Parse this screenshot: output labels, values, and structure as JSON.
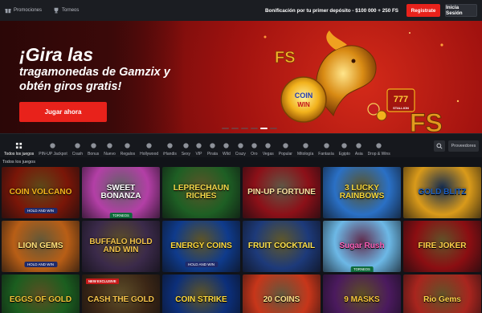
{
  "topbar": {
    "tabs": [
      {
        "label": "Promociones",
        "icon": "gift-icon"
      },
      {
        "label": "Torneos",
        "icon": "trophy-icon"
      }
    ],
    "bonus_text": "Bonificación por tu primer depósito - $100 000 + 250 FS",
    "register_label": "Registrate",
    "login_label": "Inicia Sesión"
  },
  "banner": {
    "title": "¡Gira las",
    "subtitle": "tragamonedas de Gamzix y obtén giros gratis!",
    "cta_label": "Jugar ahora",
    "art_fs": "FS",
    "art_coin": "COIN",
    "art_win": "WIN",
    "art_badge": "777",
    "art_badge_sub": "STALLION",
    "slide_count": 6,
    "active_slide": 4
  },
  "categories": [
    {
      "label": "Todos los juegos",
      "icon": "grid-icon"
    },
    {
      "label": "PIN-UP Jackpot",
      "icon": "jackpot-icon"
    },
    {
      "label": "Crash",
      "icon": "rocket-icon"
    },
    {
      "label": "Bonus",
      "icon": "bonus-icon"
    },
    {
      "label": "Nuevo",
      "icon": "new-icon"
    },
    {
      "label": "Regalos",
      "icon": "gift-icon"
    },
    {
      "label": "Hollywood",
      "icon": "star-icon"
    },
    {
      "label": "iHandis",
      "icon": "hand-icon"
    },
    {
      "label": "Sexy",
      "icon": "heart-icon"
    },
    {
      "label": "VIP",
      "icon": "crown-icon"
    },
    {
      "label": "Pirata",
      "icon": "pirate-icon"
    },
    {
      "label": "Wild",
      "icon": "wild-icon"
    },
    {
      "label": "Crazy",
      "icon": "crazy-icon"
    },
    {
      "label": "Oro",
      "icon": "gold-icon"
    },
    {
      "label": "Vegas",
      "icon": "dice-icon"
    },
    {
      "label": "Popular",
      "icon": "fire-icon"
    },
    {
      "label": "Mitología",
      "icon": "myth-icon"
    },
    {
      "label": "Fantasía",
      "icon": "wand-icon"
    },
    {
      "label": "Egipto",
      "icon": "pyramid-icon"
    },
    {
      "label": "Asia",
      "icon": "lantern-icon"
    },
    {
      "label": "Drop & Wins",
      "icon": "drop-icon"
    }
  ],
  "search_icon": "search-icon",
  "providers_label": "Proveedores",
  "section_title": "Todos los juegos",
  "games": [
    {
      "name": "COIN VOLCANO",
      "sub": "HOLD AND WIN",
      "bg": "#7a1608",
      "accent": "#f5b51b",
      "tag": "",
      "torneo": ""
    },
    {
      "name": "SWEET BONANZA",
      "sub": "",
      "bg": "#b33fa6",
      "accent": "#ffffff",
      "tag": "",
      "torneo": "TORNEOS"
    },
    {
      "name": "LEPRECHAUN RICHES",
      "sub": "",
      "bg": "#1e5f24",
      "accent": "#f2d649",
      "tag": "",
      "torneo": ""
    },
    {
      "name": "PIN-UP FORTUNE",
      "sub": "",
      "bg": "#8c1018",
      "accent": "#fbe3a2",
      "tag": "",
      "torneo": ""
    },
    {
      "name": "3 LUCKY RAINBOWS",
      "sub": "",
      "bg": "#2a70c5",
      "accent": "#f5d63b",
      "tag": "",
      "torneo": ""
    },
    {
      "name": "GOLD BLITZ",
      "sub": "",
      "bg": "#d99a1a",
      "accent": "#1b5dbf",
      "tag": "",
      "torneo": ""
    },
    {
      "name": "LION GEMS",
      "sub": "HOLD AND WIN",
      "bg": "#b85e16",
      "accent": "#ffe17a",
      "tag": "",
      "torneo": ""
    },
    {
      "name": "BUFFALO HOLD AND WIN",
      "sub": "",
      "bg": "#3b2a4a",
      "accent": "#f1c24a",
      "tag": "",
      "torneo": ""
    },
    {
      "name": "ENERGY COINS",
      "sub": "HOLD AND WIN",
      "bg": "#0f3b8c",
      "accent": "#ffd93a",
      "tag": "",
      "torneo": ""
    },
    {
      "name": "FRUIT COCKTAIL",
      "sub": "",
      "bg": "#1d3a7a",
      "accent": "#ffe24a",
      "tag": "",
      "torneo": ""
    },
    {
      "name": "Sugar Rush",
      "sub": "",
      "bg": "#6cb8e6",
      "accent": "#ff5fb8",
      "tag": "",
      "torneo": "TORNEOS"
    },
    {
      "name": "FIRE JOKER",
      "sub": "",
      "bg": "#8b0e12",
      "accent": "#ffd24a",
      "tag": "",
      "torneo": ""
    },
    {
      "name": "EGGS OF GOLD",
      "sub": "",
      "bg": "#1b5e1f",
      "accent": "#f2c536",
      "tag": "",
      "torneo": ""
    },
    {
      "name": "CASH THE GOLD",
      "sub": "",
      "bg": "#3c2716",
      "accent": "#f7c44a",
      "tag": "NEW EXCLUSIVE",
      "torneo": ""
    },
    {
      "name": "COIN STRIKE",
      "sub": "HOLD AND WIN",
      "bg": "#0c2f7a",
      "accent": "#ffd93a",
      "tag": "",
      "torneo": ""
    },
    {
      "name": "20 COINS",
      "sub": "",
      "bg": "#c7361a",
      "accent": "#ffe28a",
      "tag": "",
      "torneo": ""
    },
    {
      "name": "9 MASKS",
      "sub": "",
      "bg": "#4b1a5e",
      "accent": "#f5c53a",
      "tag": "",
      "torneo": ""
    },
    {
      "name": "Rio Gems",
      "sub": "",
      "bg": "#a8251e",
      "accent": "#ffd24a",
      "tag": "",
      "torneo": ""
    }
  ]
}
